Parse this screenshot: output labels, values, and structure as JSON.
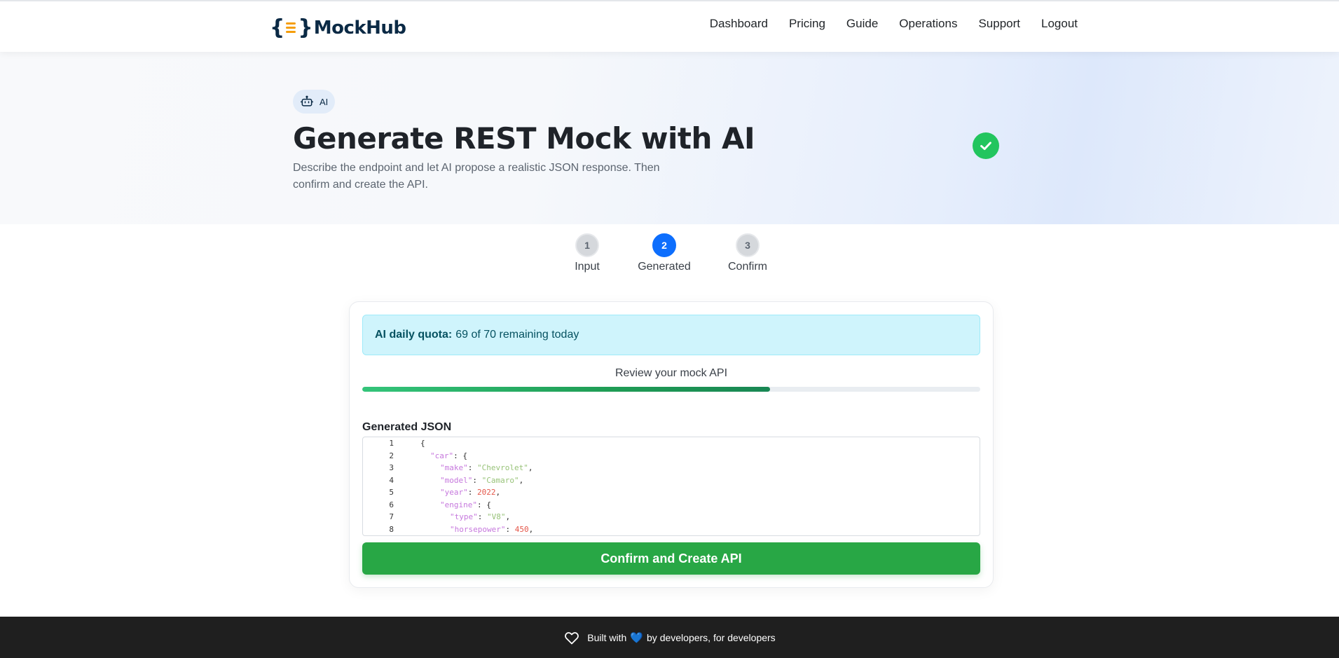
{
  "nav": {
    "brand": "MockHub",
    "links": [
      "Dashboard",
      "Pricing",
      "Guide",
      "Operations",
      "Support",
      "Logout"
    ]
  },
  "hero": {
    "chip_label": "AI",
    "title": "Generate REST Mock with AI",
    "subtitle": "Describe the endpoint and let AI propose a realistic JSON response. Then confirm and create the API."
  },
  "steps": [
    {
      "number": "1",
      "label": "Input",
      "active": false
    },
    {
      "number": "2",
      "label": "Generated",
      "active": true
    },
    {
      "number": "3",
      "label": "Confirm",
      "active": false
    }
  ],
  "card": {
    "quota_label": "AI daily quota:",
    "quota_value": "69 of 70 remaining today",
    "review_text": "Review your mock API",
    "progress_fraction": 0.66,
    "json_label": "Generated JSON",
    "confirm_label": "Confirm and Create API"
  },
  "editor": {
    "lines": [
      {
        "n": "1",
        "indent": 0,
        "tokens": [
          [
            "punc",
            "{"
          ]
        ]
      },
      {
        "n": "2",
        "indent": 1,
        "tokens": [
          [
            "key",
            "\"car\""
          ],
          [
            "punc",
            ": {"
          ]
        ]
      },
      {
        "n": "3",
        "indent": 2,
        "tokens": [
          [
            "key",
            "\"make\""
          ],
          [
            "punc",
            ": "
          ],
          [
            "str",
            "\"Chevrolet\""
          ],
          [
            "punc",
            ","
          ]
        ]
      },
      {
        "n": "4",
        "indent": 2,
        "tokens": [
          [
            "key",
            "\"model\""
          ],
          [
            "punc",
            ": "
          ],
          [
            "str",
            "\"Camaro\""
          ],
          [
            "punc",
            ","
          ]
        ]
      },
      {
        "n": "5",
        "indent": 2,
        "tokens": [
          [
            "key",
            "\"year\""
          ],
          [
            "punc",
            ": "
          ],
          [
            "num",
            "2022"
          ],
          [
            "punc",
            ","
          ]
        ]
      },
      {
        "n": "6",
        "indent": 2,
        "tokens": [
          [
            "key",
            "\"engine\""
          ],
          [
            "punc",
            ": {"
          ]
        ]
      },
      {
        "n": "7",
        "indent": 3,
        "tokens": [
          [
            "key",
            "\"type\""
          ],
          [
            "punc",
            ": "
          ],
          [
            "str",
            "\"V8\""
          ],
          [
            "punc",
            ","
          ]
        ]
      },
      {
        "n": "8",
        "indent": 3,
        "tokens": [
          [
            "key",
            "\"horsepower\""
          ],
          [
            "punc",
            ": "
          ],
          [
            "num",
            "450"
          ],
          [
            "punc",
            ","
          ]
        ]
      }
    ]
  },
  "footer": {
    "text_before": "Built with",
    "heart": "💙",
    "text_after": "by developers, for developers"
  },
  "colors": {
    "primary": "#0d6efd",
    "success": "#28a745",
    "check": "#22c55e",
    "quota_bg": "#cff4fc",
    "footer_bg": "#1f1f1f"
  },
  "icons": {
    "chip": "robot-icon",
    "hero_status": "check-circle-icon",
    "footer": "heart-outline-icon"
  }
}
